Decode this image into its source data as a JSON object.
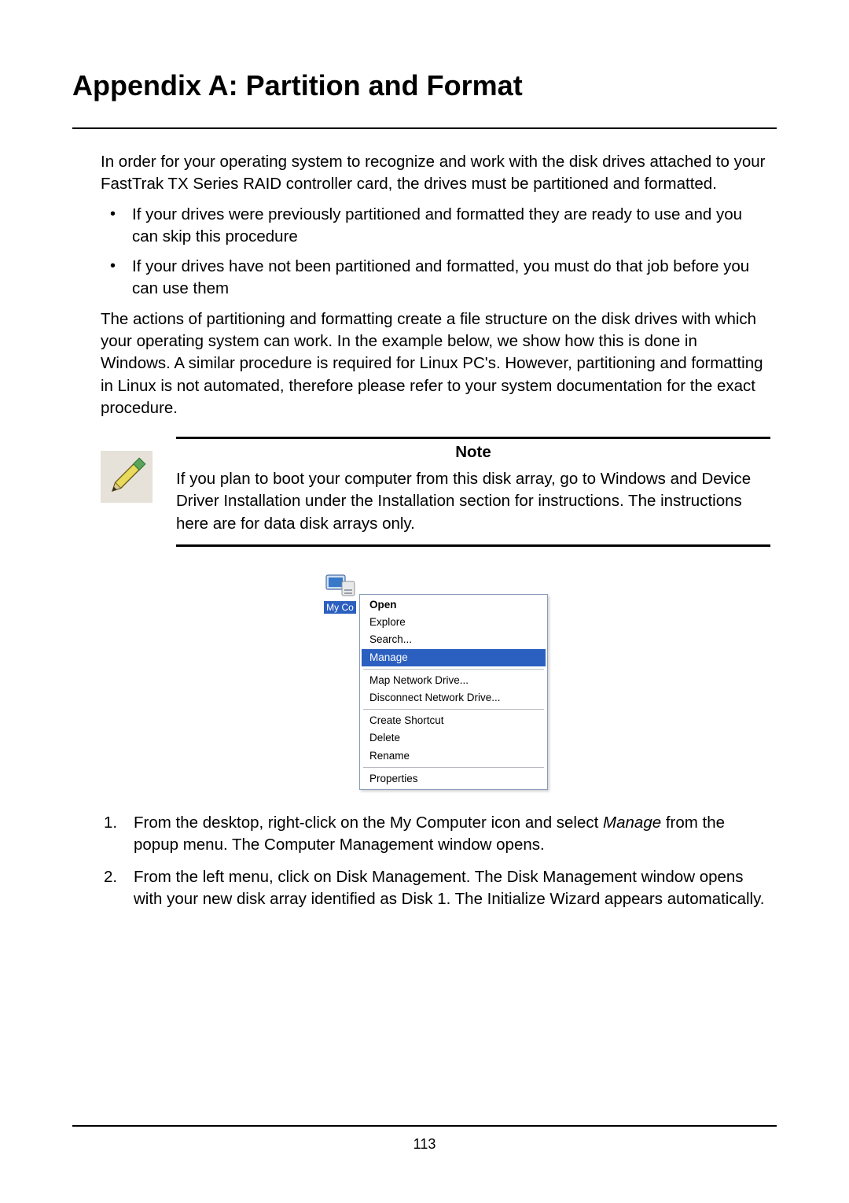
{
  "title": "Appendix A: Partition and Format",
  "intro": "In order for your operating system to recognize and work with the disk drives attached to your FastTrak TX Series RAID controller card, the drives must be partitioned and formatted.",
  "bullets": [
    "If your drives were previously partitioned and formatted they are ready to use and you can skip this procedure",
    "If your drives have not been partitioned and formatted, you must do that job before you can use them"
  ],
  "para2": "The actions of partitioning and formatting create a file structure on the disk drives with which your operating system can work. In the example below, we show how this is done in Windows. A similar procedure is required for Linux PC's. However, partitioning and formatting in Linux is not automated, therefore please refer to your system documentation for the exact procedure.",
  "note": {
    "title": "Note",
    "text": "If you plan to boot your computer from this disk array, go to Windows and Device Driver Installation under the Installation section for instructions. The instructions here are for data disk arrays only."
  },
  "context_menu": {
    "icon_label": "My Co",
    "groups": [
      [
        {
          "label": "Open",
          "bold": true,
          "selected": false
        },
        {
          "label": "Explore",
          "bold": false,
          "selected": false
        },
        {
          "label": "Search...",
          "bold": false,
          "selected": false
        },
        {
          "label": "Manage",
          "bold": false,
          "selected": true
        }
      ],
      [
        {
          "label": "Map Network Drive...",
          "bold": false,
          "selected": false
        },
        {
          "label": "Disconnect Network Drive...",
          "bold": false,
          "selected": false
        }
      ],
      [
        {
          "label": "Create Shortcut",
          "bold": false,
          "selected": false
        },
        {
          "label": "Delete",
          "bold": false,
          "selected": false
        },
        {
          "label": "Rename",
          "bold": false,
          "selected": false
        }
      ],
      [
        {
          "label": "Properties",
          "bold": false,
          "selected": false
        }
      ]
    ]
  },
  "steps": {
    "s1a": "From the desktop, right-click on the My Computer icon and select ",
    "s1b": "Manage",
    "s1c": " from the popup menu. The Computer Management window opens.",
    "s2": "From the left menu, click on Disk Management. The Disk Management window opens with your new disk array identified as Disk 1. The Initialize Wizard appears automatically."
  },
  "page_number": "113"
}
